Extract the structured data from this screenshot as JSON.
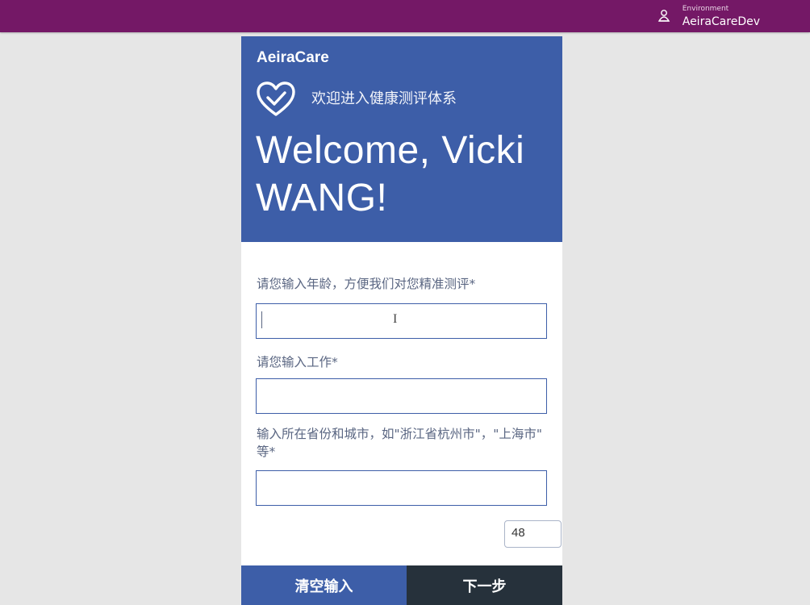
{
  "env": {
    "caption": "Environment",
    "name": "AeiraCareDev"
  },
  "app": {
    "name": "AeiraCare",
    "subtitle": "欢迎进入健康测评体系",
    "welcome": "Welcome, Vicki WANG!"
  },
  "form": {
    "age_label": "请您输入年龄，方便我们对您精准测评*",
    "age_value": "",
    "job_label": "请您输入工作*",
    "job_value": "",
    "city_label": "输入所在省份和城市，如\"浙江省杭州市\"，\"上海市\" 等*",
    "city_value": "",
    "age_display": "48"
  },
  "buttons": {
    "clear": "清空输入",
    "next": "下一步"
  },
  "colors": {
    "topbar": "#741866",
    "brand_blue": "#3d5ea8",
    "dark_button": "#26313b"
  },
  "icons": {
    "env": "environment-icon",
    "heart": "heart-check-icon"
  }
}
